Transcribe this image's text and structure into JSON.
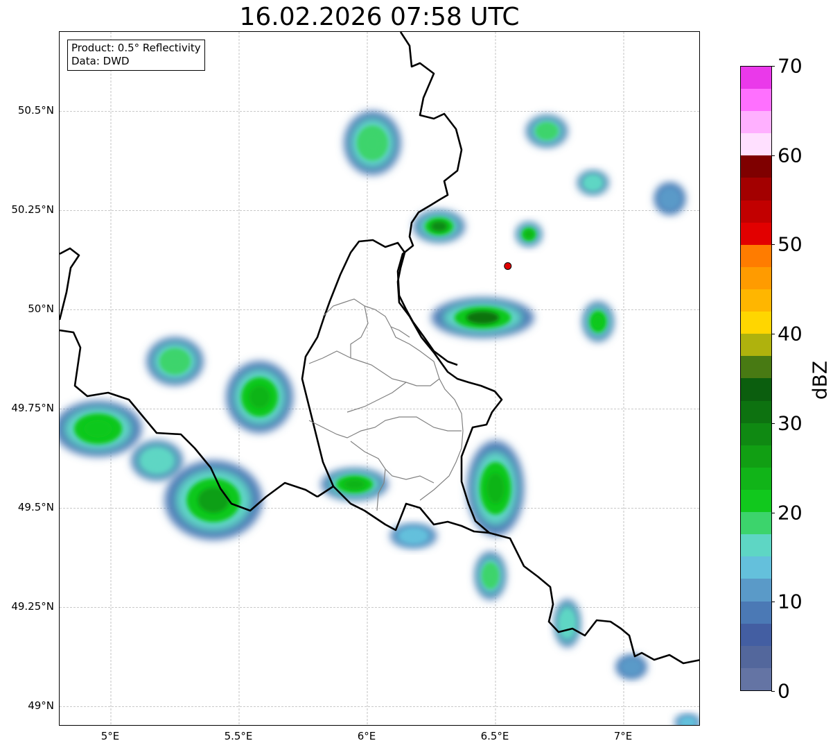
{
  "title": "16.02.2026 07:58 UTC",
  "info": {
    "product": "Product: 0.5° Reflectivity",
    "source": "Data: DWD"
  },
  "map": {
    "lon_range": [
      4.8,
      7.3
    ],
    "lat_range": [
      48.95,
      50.7
    ],
    "x_ticks": [
      {
        "value": 5.0,
        "label": "5°E"
      },
      {
        "value": 5.5,
        "label": "5.5°E"
      },
      {
        "value": 6.0,
        "label": "6°E"
      },
      {
        "value": 6.5,
        "label": "6.5°E"
      },
      {
        "value": 7.0,
        "label": "7°E"
      }
    ],
    "y_ticks": [
      {
        "value": 50.5,
        "label": "50.5°N"
      },
      {
        "value": 50.25,
        "label": "50.25°N"
      },
      {
        "value": 50.0,
        "label": "50°N"
      },
      {
        "value": 49.75,
        "label": "49.75°N"
      },
      {
        "value": 49.5,
        "label": "49.5°N"
      },
      {
        "value": 49.25,
        "label": "49.25°N"
      },
      {
        "value": 49.0,
        "label": "49°N"
      }
    ],
    "gridlines": true,
    "radar_site": {
      "lon": 6.548,
      "lat": 50.11,
      "color": "#e00000"
    },
    "echo_cells": [
      {
        "lon": 4.95,
        "lat": 49.7,
        "rlon": 0.17,
        "rlat": 0.07,
        "dbz": 22
      },
      {
        "lon": 5.25,
        "lat": 49.87,
        "rlon": 0.11,
        "rlat": 0.06,
        "dbz": 19
      },
      {
        "lon": 5.58,
        "lat": 49.78,
        "rlon": 0.13,
        "rlat": 0.09,
        "dbz": 24
      },
      {
        "lon": 5.4,
        "lat": 49.52,
        "rlon": 0.19,
        "rlat": 0.1,
        "dbz": 26
      },
      {
        "lon": 5.18,
        "lat": 49.62,
        "rlon": 0.1,
        "rlat": 0.05,
        "dbz": 16
      },
      {
        "lon": 5.95,
        "lat": 49.56,
        "rlon": 0.13,
        "rlat": 0.04,
        "dbz": 24
      },
      {
        "lon": 6.18,
        "lat": 49.43,
        "rlon": 0.09,
        "rlat": 0.03,
        "dbz": 14
      },
      {
        "lon": 6.5,
        "lat": 49.55,
        "rlon": 0.11,
        "rlat": 0.12,
        "dbz": 23
      },
      {
        "lon": 6.48,
        "lat": 49.33,
        "rlon": 0.06,
        "rlat": 0.06,
        "dbz": 19
      },
      {
        "lon": 6.78,
        "lat": 49.21,
        "rlon": 0.05,
        "rlat": 0.06,
        "dbz": 17
      },
      {
        "lon": 6.45,
        "lat": 49.98,
        "rlon": 0.2,
        "rlat": 0.05,
        "dbz": 32
      },
      {
        "lon": 6.28,
        "lat": 50.21,
        "rlon": 0.1,
        "rlat": 0.04,
        "dbz": 29
      },
      {
        "lon": 6.02,
        "lat": 50.42,
        "rlon": 0.11,
        "rlat": 0.08,
        "dbz": 19
      },
      {
        "lon": 6.7,
        "lat": 50.45,
        "rlon": 0.08,
        "rlat": 0.04,
        "dbz": 18
      },
      {
        "lon": 6.88,
        "lat": 50.32,
        "rlon": 0.06,
        "rlat": 0.03,
        "dbz": 17
      },
      {
        "lon": 6.9,
        "lat": 49.97,
        "rlon": 0.06,
        "rlat": 0.05,
        "dbz": 20
      },
      {
        "lon": 6.63,
        "lat": 50.19,
        "rlon": 0.05,
        "rlat": 0.03,
        "dbz": 24
      },
      {
        "lon": 7.18,
        "lat": 50.28,
        "rlon": 0.06,
        "rlat": 0.04,
        "dbz": 12
      },
      {
        "lon": 7.03,
        "lat": 49.1,
        "rlon": 0.06,
        "rlat": 0.03,
        "dbz": 11
      },
      {
        "lon": 7.25,
        "lat": 48.96,
        "rlon": 0.05,
        "rlat": 0.02,
        "dbz": 13
      }
    ]
  },
  "colorbar": {
    "label": "dBZ",
    "min": 0,
    "max": 70,
    "ticks": [
      0,
      10,
      20,
      30,
      40,
      50,
      60,
      70
    ],
    "colors": [
      "#6474a4",
      "#53679c",
      "#435ea2",
      "#4b79b5",
      "#5a9ac8",
      "#64c0dc",
      "#5ed6c4",
      "#3cd46c",
      "#11c81d",
      "#11b418",
      "#119f13",
      "#0f8912",
      "#0d7210",
      "#0b5e0e",
      "#487a13",
      "#afb20d",
      "#ffd600",
      "#ffb600",
      "#ff9b00",
      "#ff7c00",
      "#e20000",
      "#c20000",
      "#a30000",
      "#7f0000",
      "#ffe0ff",
      "#ffb0ff",
      "#ff70ff",
      "#ea39ea"
    ]
  }
}
